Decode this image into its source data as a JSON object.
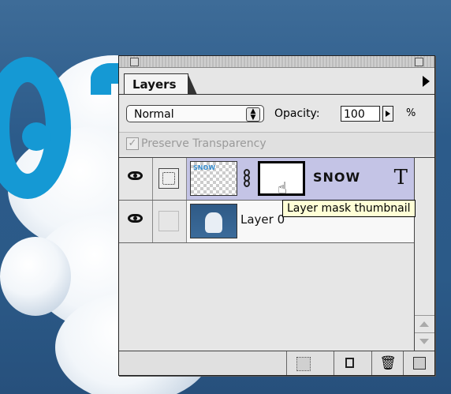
{
  "palette": {
    "tab_label": "Layers",
    "blend_mode": "Normal",
    "opacity_label": "Opacity:",
    "opacity_value": "100",
    "opacity_unit": "%",
    "preserve_transparency_label": "Preserve Transparency",
    "preserve_transparency_checked": true,
    "layers": [
      {
        "name": "SNOW",
        "visible": true,
        "thumbnail_text": "SNOW",
        "has_mask": true,
        "type_layer": true,
        "type_icon": "T",
        "selected": true
      },
      {
        "name": "Layer 0",
        "visible": true,
        "has_mask": false,
        "type_layer": false,
        "selected": false
      }
    ],
    "bottom_buttons": [
      "add-mask-icon",
      "new-layer-icon",
      "trash-icon",
      "grow-box-icon"
    ]
  },
  "tooltip": {
    "text": "Layer mask thumbnail"
  },
  "icons": {
    "eye": "eye-icon",
    "link": "chain-link-icon",
    "type": "T",
    "trash": "🗑",
    "cursor": "pointing-hand-cursor"
  },
  "colors": {
    "selected_row": "#c4c4e6",
    "tooltip_bg": "#ffffd6",
    "accent_letter": "#1599d4"
  }
}
